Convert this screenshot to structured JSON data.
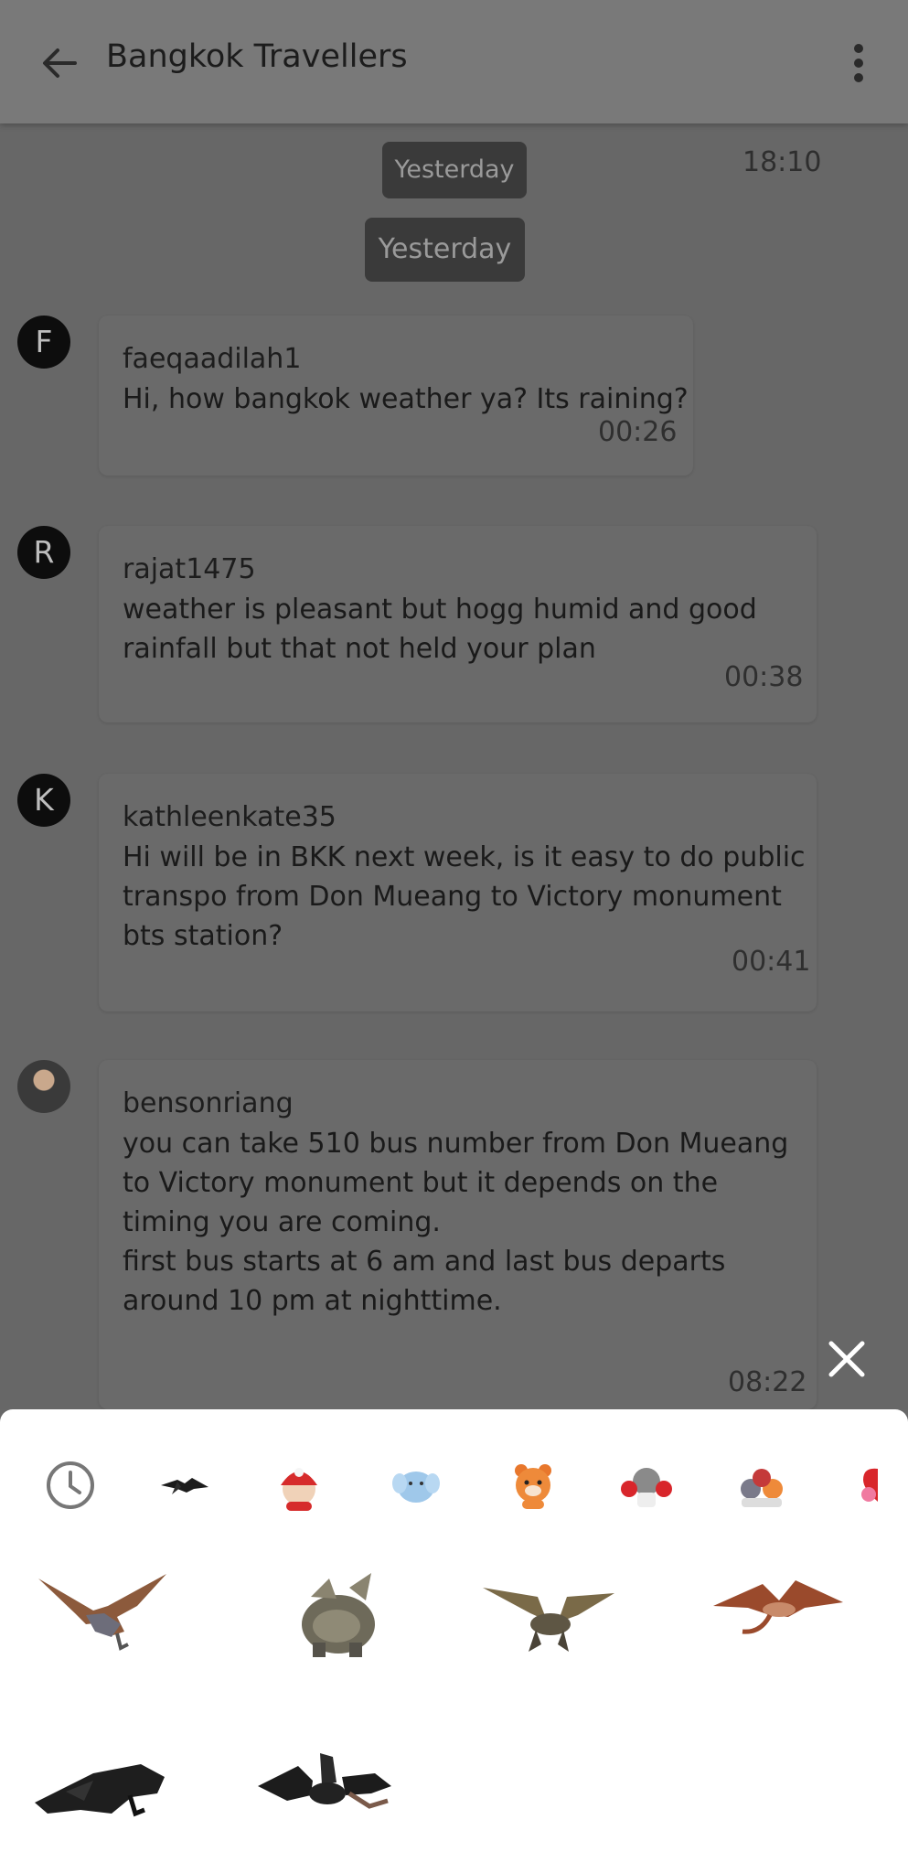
{
  "header": {
    "title": "Bangkok Travellers"
  },
  "chat": {
    "date_chip_1": "Yesterday",
    "date_chip_2": "Yesterday",
    "top_time": "18:10",
    "messages": [
      {
        "avatar_letter": "F",
        "author": "faeqaadilah1",
        "lines": [
          "Hi, how bangkok weather ya? Its raining?"
        ],
        "time": "00:26"
      },
      {
        "avatar_letter": "R",
        "author": "rajat1475",
        "lines": [
          "weather is pleasant but hogg humid and good",
          "rainfall but that not held your plan"
        ],
        "time": "00:38"
      },
      {
        "avatar_letter": "K",
        "author": "kathleenkate35",
        "lines": [
          "Hi will be in BKK next week, is it easy to do public",
          "transpo from Don Mueang to Victory monument",
          "bts station?"
        ],
        "time": "00:41"
      },
      {
        "avatar_letter": "",
        "author": "bensonriang",
        "lines": [
          "you can take 510 bus number from Don Mueang",
          "to Victory monument but it depends on the",
          "timing you are coming.",
          "first bus starts at 6 am and last bus departs",
          "around 10 pm at nighttime."
        ],
        "time": "08:22"
      }
    ]
  },
  "sticker_picker": {
    "tabs": [
      "recent-icon",
      "dragon-pack-icon",
      "red-hat-kid-pack-icon",
      "elephant-pack-icon",
      "bear-pack-icon",
      "pompom-bear-pack-icon",
      "friends-pack-icon",
      "hearts-pack-icon"
    ],
    "stickers": [
      "dragon-sticker",
      "dragon-sticker",
      "dragon-sticker",
      "dragon-sticker",
      "dragon-sticker",
      "dragon-sticker"
    ]
  },
  "colors": {
    "scrim": "#686868",
    "date_chip": "#3a3a3a",
    "sheet": "#ffffff"
  }
}
